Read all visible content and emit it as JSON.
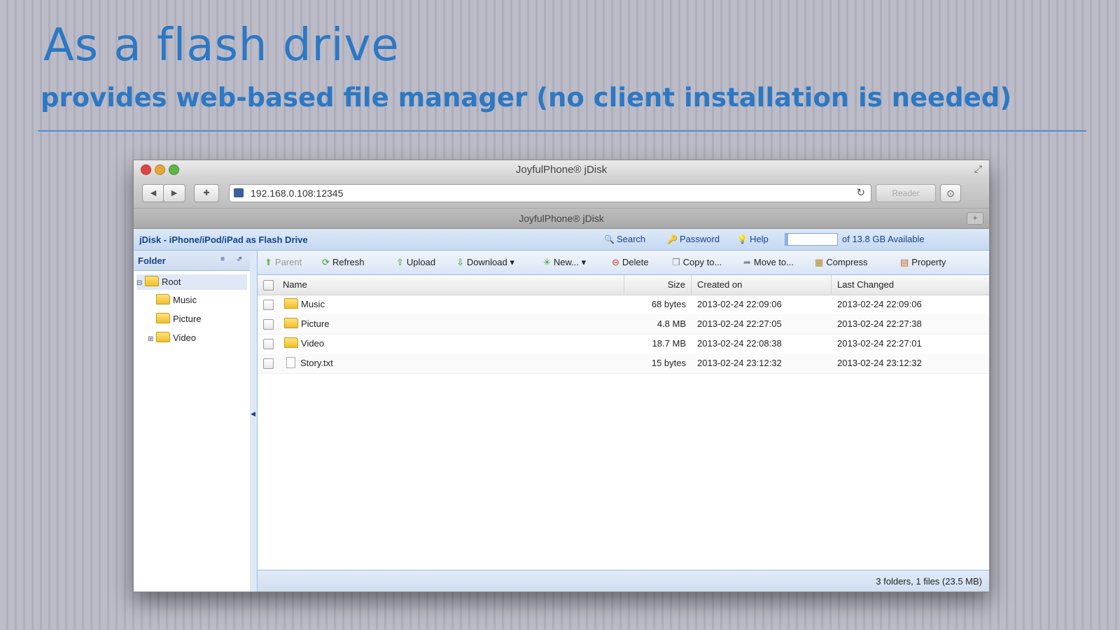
{
  "slide": {
    "title": "As a flash drive",
    "subtitle": "provides web-based file manager (no client installation is needed)",
    "accent_color": "#2c78c4"
  },
  "browser": {
    "window_title": "JoyfulPhone® jDisk",
    "url": "192.168.0.108:12345",
    "tab_title": "JoyfulPhone® jDisk",
    "reader_label": "Reader",
    "icons": {
      "back": "back-arrow-icon",
      "forward": "forward-arrow-icon",
      "share": "share-icon",
      "reload": "reload-icon",
      "download": "downloads-icon",
      "fullscreen": "fullscreen-icon"
    }
  },
  "app": {
    "breadcrumb": "jDisk - iPhone/iPod/iPad as Flash Drive",
    "header_links": {
      "search": "Search",
      "password": "Password",
      "help": "Help"
    },
    "quota": {
      "used_fraction": 0.05,
      "text": "of 13.8 GB Available"
    },
    "sidebar": {
      "header": "Folder",
      "tree": [
        {
          "label": "Root",
          "level": 0,
          "expanded": true,
          "selected": true
        },
        {
          "label": "Music",
          "level": 1
        },
        {
          "label": "Picture",
          "level": 1
        },
        {
          "label": "Video",
          "level": 1,
          "collapsed": true
        }
      ]
    },
    "actions": {
      "parent": "Parent",
      "refresh": "Refresh",
      "upload": "Upload",
      "download": "Download",
      "new": "New...",
      "delete": "Delete",
      "copy": "Copy to...",
      "move": "Move to...",
      "compress": "Compress",
      "property": "Property"
    },
    "columns": {
      "name": "Name",
      "size": "Size",
      "created": "Created on",
      "changed": "Last Changed"
    },
    "files": [
      {
        "name": "Music",
        "type": "folder",
        "size": "68 bytes",
        "created": "2013-02-24 22:09:06",
        "changed": "2013-02-24 22:09:06"
      },
      {
        "name": "Picture",
        "type": "folder",
        "size": "4.8 MB",
        "created": "2013-02-24 22:27:05",
        "changed": "2013-02-24 22:27:38"
      },
      {
        "name": "Video",
        "type": "folder",
        "size": "18.7 MB",
        "created": "2013-02-24 22:08:38",
        "changed": "2013-02-24 22:27:01"
      },
      {
        "name": "Story.txt",
        "type": "file",
        "size": "15 bytes",
        "created": "2013-02-24 23:12:32",
        "changed": "2013-02-24 23:12:32"
      }
    ],
    "status": "3 folders, 1 files (23.5 MB)"
  }
}
